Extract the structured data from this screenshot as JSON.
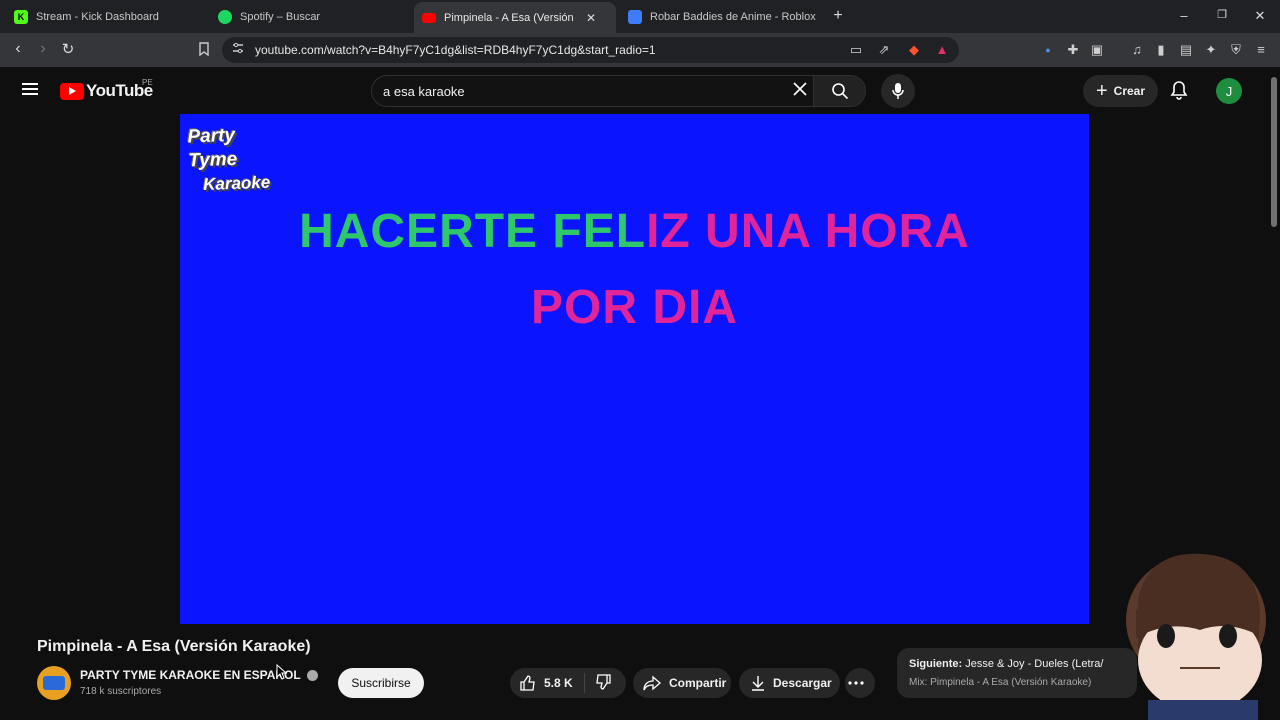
{
  "tabs": [
    {
      "title": "Stream - Kick Dashboard",
      "icon": "kick-icon"
    },
    {
      "title": "Spotify – Buscar",
      "icon": "spotify-icon"
    },
    {
      "title": "Pimpinela - A Esa (Versión Ka",
      "icon": "youtube-icon",
      "active": true
    },
    {
      "title": "Robar Baddies de Anime - Roblox",
      "icon": "roblox-icon"
    }
  ],
  "address_bar": {
    "url": "youtube.com/watch?v=B4hyF7yC1dg&list=RDB4hyF7yC1dg&start_radio=1"
  },
  "youtube": {
    "logo_text": "YouTube",
    "country_code": "PE",
    "search_value": "a esa karaoke",
    "create_label": "Crear",
    "avatar_letter": "J"
  },
  "video": {
    "watermark_line1": "Party Tyme",
    "watermark_line2": "Karaoke",
    "lyric_line1_sung": "HACERTE FEL",
    "lyric_line1_unsung": "IZ UNA HORA",
    "lyric_line2": "POR DIA",
    "sung_color": "#2ec86a",
    "unsung_color": "#e0249a",
    "background_color": "#0a14ff"
  },
  "details": {
    "title": "Pimpinela - A Esa (Versión Karaoke)",
    "channel_name": "PARTY TYME KARAOKE EN ESPAÑOL",
    "subscribers": "718 k suscriptores",
    "subscribe_label": "Suscribirse",
    "likes": "5.8 K",
    "share_label": "Compartir",
    "download_label": "Descargar"
  },
  "up_next": {
    "label": "Siguiente:",
    "title": "Jesse & Joy - Dueles (Letra/",
    "mix": "Mix: Pimpinela - A Esa (Versión Karaoke)"
  }
}
